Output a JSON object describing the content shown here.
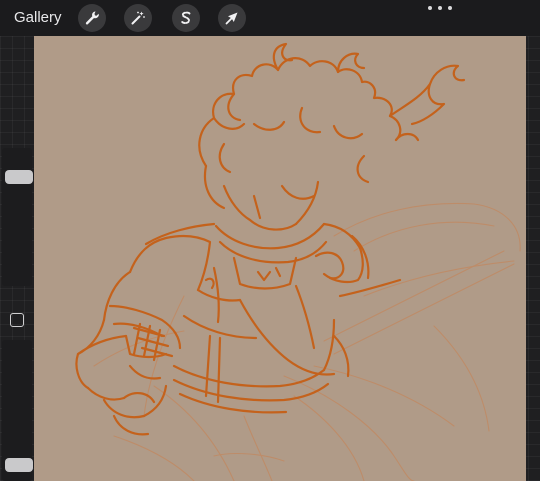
{
  "topbar": {
    "gallery_label": "Gallery",
    "tools": [
      {
        "name": "actions",
        "icon": "wrench-icon"
      },
      {
        "name": "adjustments",
        "icon": "magic-wand-icon"
      },
      {
        "name": "selection",
        "icon": "selection-s-icon"
      },
      {
        "name": "transform",
        "icon": "arrow-cursor-icon"
      }
    ],
    "more_icon": "ellipsis-icon"
  },
  "sidebar": {
    "brush_size": 0.83,
    "opacity": 0.06,
    "modifier_icon": "square-modifier-icon"
  },
  "colors": {
    "ui_background": "#1f1f21",
    "topbar": "#1b1b1d",
    "canvas_paper": "#b09b88",
    "sketch_stroke": "#c4621c",
    "sketch_faint": "#c98050",
    "icon_button_bg": "#3a3a3c"
  }
}
